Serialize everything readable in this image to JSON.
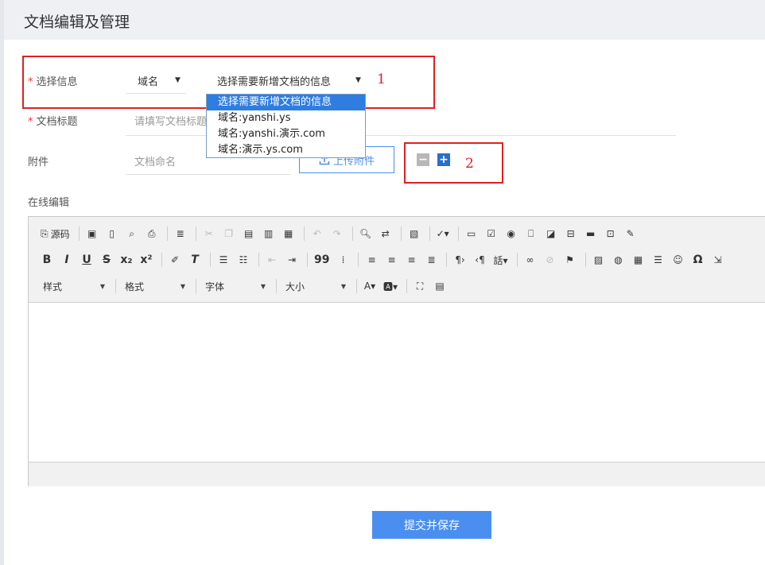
{
  "header": {
    "title": "文档编辑及管理"
  },
  "form": {
    "select_info": {
      "label": "选择信息",
      "required": "*",
      "type_select": "域名",
      "info_select": "选择需要新增文档的信息",
      "dropdown_options": [
        "选择需要新增文档的信息",
        "域名:yanshi.ys",
        "域名:yanshi.演示.com",
        "域名:演示.ys.com"
      ]
    },
    "doc_title": {
      "label": "文档标题",
      "required": "*",
      "placeholder": "请填写文档标题"
    },
    "attachment": {
      "label": "附件",
      "placeholder": "文档命名",
      "upload_label": "上传附件",
      "minus": "−",
      "plus": "+"
    },
    "online_edit": {
      "label": "在线编辑"
    }
  },
  "annotations": [
    "1",
    "2"
  ],
  "toolbar": {
    "row1": [
      "源码"
    ],
    "row2": [
      "B",
      "I",
      "U",
      "S",
      "x₂",
      "x²",
      "T",
      "99",
      "Ω"
    ],
    "combos": [
      "样式",
      "格式",
      "字体",
      "大小"
    ]
  },
  "submit_label": "提交并保存",
  "colors": {
    "accent": "#4a8ff0",
    "annotation": "#e02020",
    "selected": "#2f7de1"
  }
}
